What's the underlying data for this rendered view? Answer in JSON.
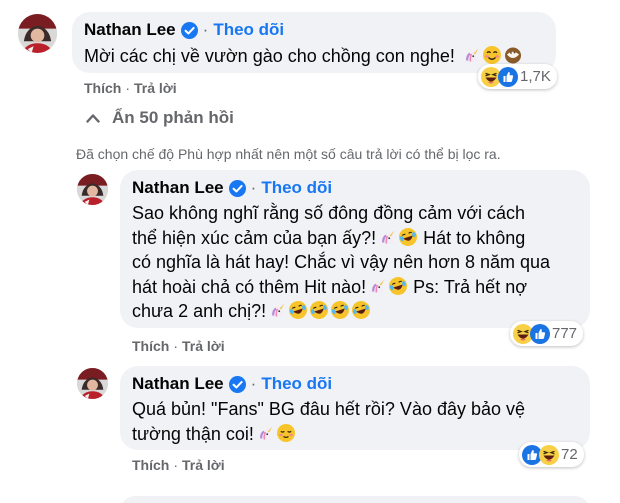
{
  "colors": {
    "link": "#1877f2",
    "muted": "#65676b",
    "bubble": "#f0f2f5"
  },
  "top_comment": {
    "author": "Nathan Lee",
    "follow": "Theo dõi",
    "text": "Mời các chị về vườn gào cho chồng con nghe!",
    "emojis": [
      "unicorn-icon",
      "smiling-face-icon",
      "coconut-icon"
    ],
    "reactions": {
      "icons": [
        "haha-icon",
        "like-icon"
      ],
      "count": "1,7K"
    },
    "actions": {
      "like": "Thích",
      "reply": "Trả lời"
    }
  },
  "hide_replies_label": "Ẩn 50 phản hồi",
  "filter_note": "Đã chọn chế độ Phù hợp nhất nên một số câu trả lời có thể bị lọc ra.",
  "replies": [
    {
      "author": "Nathan Lee",
      "follow": "Theo dõi",
      "lines": [
        "Sao không nghĩ rằng số đông đồng cảm với cách",
        "thể hiện xúc cảm của bạn ấy?!",
        "Hát to không",
        "có nghĩa là hát hay! Chắc vì vậy nên hơn 8 năm qua",
        "hát hoài chả có thêm Hit nào!",
        "Ps: Trả hết nợ",
        "chưa 2 anh chị?!"
      ],
      "reactions": {
        "icons": [
          "haha-icon",
          "like-icon"
        ],
        "count": "777"
      },
      "actions": {
        "like": "Thích",
        "reply": "Trả lời"
      }
    },
    {
      "author": "Nathan Lee",
      "follow": "Theo dõi",
      "lines": [
        "Quá bủn! \"Fans\" BG đâu hết rồi? Vào đây bảo vệ",
        "tường thận coi!"
      ],
      "reactions": {
        "icons": [
          "like-icon",
          "haha-icon"
        ],
        "count": "72"
      },
      "actions": {
        "like": "Thích",
        "reply": "Trả lời"
      }
    }
  ]
}
